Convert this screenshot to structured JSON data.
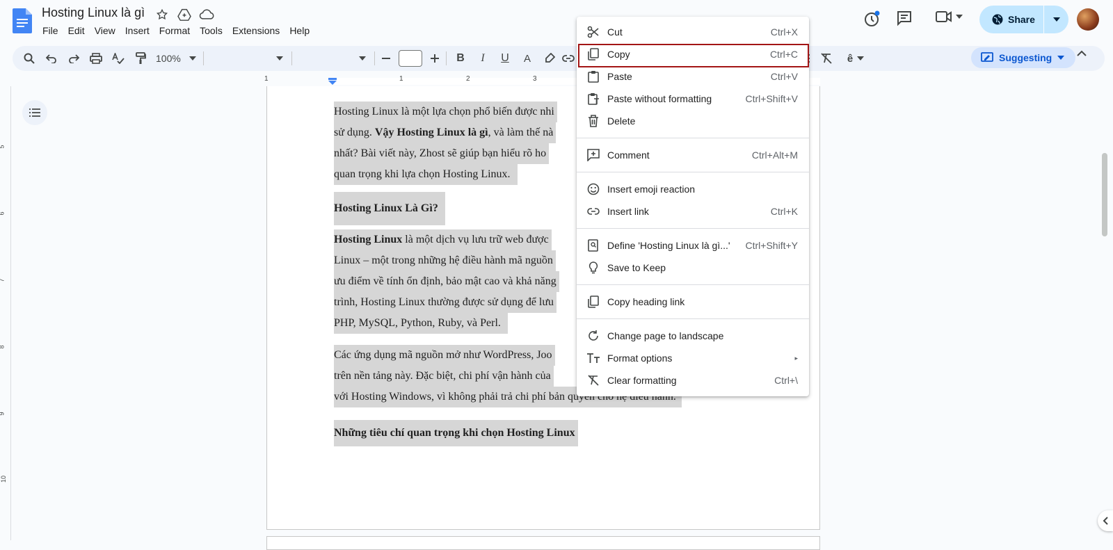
{
  "document": {
    "title": "Hosting Linux là gì"
  },
  "menubar": [
    "File",
    "Edit",
    "View",
    "Insert",
    "Format",
    "Tools",
    "Extensions",
    "Help"
  ],
  "share": {
    "label": "Share"
  },
  "toolbar": {
    "zoom": "100%",
    "font_size": "",
    "mode": "Suggesting"
  },
  "ruler": {
    "numbers": [
      "1",
      "1",
      "2",
      "3"
    ]
  },
  "vertical_ruler": {
    "numbers": [
      "5",
      "6",
      "7",
      "8",
      "9",
      "10"
    ]
  },
  "content": {
    "p1": {
      "l1": "Hosting Linux là một lựa chọn phổ biến được nhi",
      "l2a": "sử dụng. ",
      "l2b": "Vậy Hosting Linux là gì",
      "l2c": ", và làm thế nà",
      "l3": "nhất? Bài viết này, Zhost sẽ giúp bạn hiểu rõ ho",
      "l4": "quan trọng khi lựa chọn Hosting Linux."
    },
    "h1": "Hosting Linux Là Gì?",
    "p2": {
      "l1a": "Hosting Linux",
      "l1b": " là một dịch vụ lưu trữ web được",
      "l2": "Linux – một trong những hệ điều hành mã nguồn",
      "l3": "ưu điểm về tính ổn định, bảo mật cao và khả năng",
      "l4": "trình, Hosting Linux thường được sử dụng để lưu",
      "l5": "PHP, MySQL, Python, Ruby, và Perl."
    },
    "p3": {
      "l1": "Các ứng dụng mã nguồn mở như WordPress, Joo",
      "l2": "trên nền tảng này. Đặc biệt, chi phí vận hành của",
      "l3": "với Hosting Windows, vì không phải trả chi phí bản quyền cho hệ điều hành."
    },
    "h2": "Những tiêu chí quan trọng khi chọn Hosting Linux"
  },
  "context_menu": {
    "cut": {
      "label": "Cut",
      "shortcut": "Ctrl+X",
      "icon": "scissors-icon"
    },
    "copy": {
      "label": "Copy",
      "shortcut": "Ctrl+C",
      "icon": "copy-icon"
    },
    "paste": {
      "label": "Paste",
      "shortcut": "Ctrl+V",
      "icon": "clipboard-icon"
    },
    "paste_plain": {
      "label": "Paste without formatting",
      "shortcut": "Ctrl+Shift+V",
      "icon": "clipboard-plain-icon"
    },
    "delete": {
      "label": "Delete",
      "shortcut": "",
      "icon": "trash-icon"
    },
    "comment": {
      "label": "Comment",
      "shortcut": "Ctrl+Alt+M",
      "icon": "add-comment-icon"
    },
    "emoji": {
      "label": "Insert emoji reaction",
      "shortcut": "",
      "icon": "smiley-icon"
    },
    "link": {
      "label": "Insert link",
      "shortcut": "Ctrl+K",
      "icon": "link-icon"
    },
    "define": {
      "label": "Define 'Hosting Linux là gì...'",
      "shortcut": "Ctrl+Shift+Y",
      "icon": "dictionary-icon"
    },
    "keep": {
      "label": "Save to Keep",
      "shortcut": "",
      "icon": "lightbulb-icon"
    },
    "heading_link": {
      "label": "Copy heading link",
      "shortcut": "",
      "icon": "copy-link-icon"
    },
    "landscape": {
      "label": "Change page to landscape",
      "shortcut": "",
      "icon": "rotate-icon"
    },
    "format": {
      "label": "Format options",
      "shortcut": "▸",
      "icon": "text-format-icon"
    },
    "clear": {
      "label": "Clear formatting",
      "shortcut": "Ctrl+\\",
      "icon": "clear-format-icon"
    }
  },
  "colors": {
    "accent": "#0b57d0",
    "share_bg": "#c2e7ff",
    "selection": "#d6d6d6",
    "highlight_box": "#a31515"
  }
}
